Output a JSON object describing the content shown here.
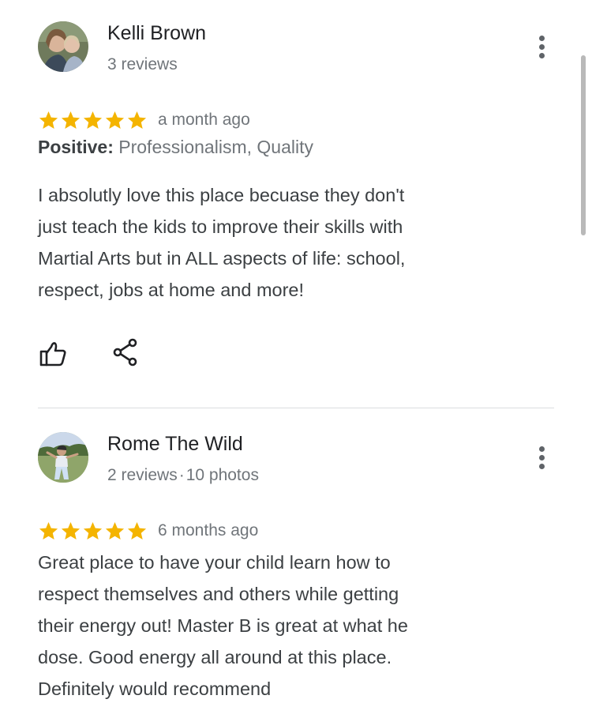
{
  "colors": {
    "star": "#f4b400",
    "text_secondary": "#70757a",
    "divider": "#dadce0"
  },
  "reviews": [
    {
      "author": "Kelli Brown",
      "stats": "3 reviews",
      "rating": 5,
      "time": "a month ago",
      "attributes_label": "Positive:",
      "attributes_value": " Professionalism, Quality",
      "text_lines": [
        "I absolutly love this place becuase they don't",
        "just teach the kids to improve their skills with",
        "Martial Arts but in ALL aspects of life: school,",
        "respect, jobs at home and more!"
      ],
      "actions": [
        "thumbs-up-icon",
        "share-icon"
      ]
    },
    {
      "author": "Rome The Wild",
      "stats_reviews": "2 reviews",
      "stats_sep": "·",
      "stats_photos": "10 photos",
      "rating": 5,
      "time": "6 months ago",
      "text_lines": [
        "Great place to have your child learn how to",
        "respect themselves and others while getting",
        "their energy out! Master B is great at what he",
        "dose. Good energy all around at this place.",
        "Definitely would recommend"
      ]
    }
  ]
}
